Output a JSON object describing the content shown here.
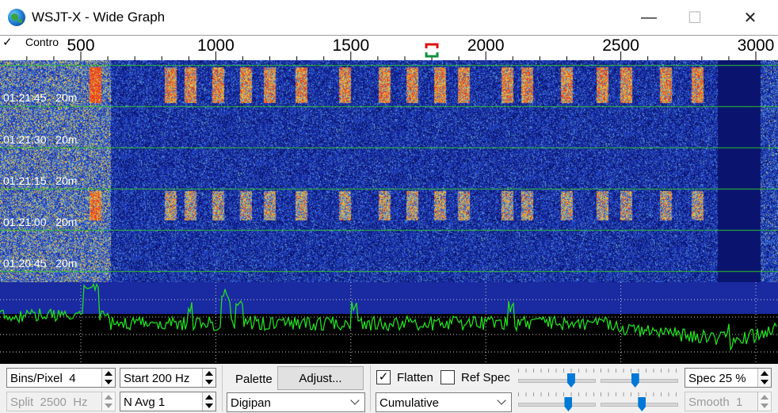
{
  "window": {
    "title": "WSJT-X - Wide Graph",
    "minimize_glyph": "—",
    "maximize_glyph": "☐",
    "close_glyph": "✕"
  },
  "scale": {
    "control_label": "Contro",
    "control_checked": true,
    "ticks": [
      {
        "hz": 500,
        "label": "500"
      },
      {
        "hz": 1000,
        "label": "1000"
      },
      {
        "hz": 1500,
        "label": "1500"
      },
      {
        "hz": 2000,
        "label": "2000"
      },
      {
        "hz": 2500,
        "label": "2500"
      },
      {
        "hz": 3000,
        "label": "3000"
      }
    ],
    "marker_hz": 1800
  },
  "waterfall": {
    "timestamps": [
      "01:21:45   20m",
      "01:21:30   20m",
      "01:21:15   20m",
      "01:21:00   20m",
      "01:20:45   20m"
    ]
  },
  "controls": {
    "bins_per_pixel": "Bins/Pixel  4",
    "start": "Start 200 Hz",
    "split": "Split  2500  Hz",
    "n_avg": "N Avg 1",
    "palette_label": "Palette",
    "adjust_label": "Adjust...",
    "palette_value": "Digipan",
    "flatten_label": "Flatten",
    "flatten_checked": true,
    "ref_spec_label": "Ref Spec",
    "ref_spec_checked": false,
    "spectrum_mode": "Cumulative",
    "spec_percent": "Spec 25 %",
    "smooth": "Smooth  1"
  },
  "sliders": [
    {
      "name": "gain",
      "value": 0.72
    },
    {
      "name": "zero",
      "value": 0.45
    },
    {
      "name": "graph-gain",
      "value": 0.68
    },
    {
      "name": "graph-zero",
      "value": 0.55
    }
  ],
  "colors": {
    "waterfall_bg": "#0a1670",
    "spectrum_bg": "#1a2aa0",
    "spectrum_line": "#22dd22",
    "grid_green": "#2fc22f",
    "accent": "#0078d7"
  }
}
